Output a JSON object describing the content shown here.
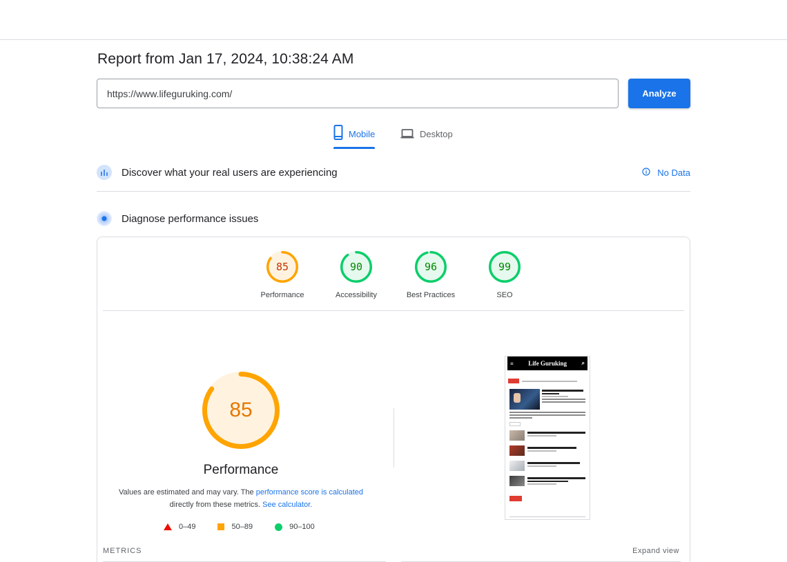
{
  "report": {
    "title": "Report from Jan 17, 2024, 10:38:24 AM"
  },
  "search": {
    "url": "https://www.lifeguruking.com/",
    "analyze_label": "Analyze"
  },
  "tabs": [
    {
      "label": "Mobile",
      "active": true,
      "icon": "smartphone-icon"
    },
    {
      "label": "Desktop",
      "active": false,
      "icon": "laptop-icon"
    }
  ],
  "field_data": {
    "title": "Discover what your real users are experiencing",
    "status": "No Data"
  },
  "diagnose": {
    "title": "Diagnose performance issues"
  },
  "scores": [
    {
      "label": "Performance",
      "value": 85,
      "color": "#ffa400",
      "text_color": "#c33300",
      "fill": "#fff3e0"
    },
    {
      "label": "Accessibility",
      "value": 90,
      "color": "#0cce6b",
      "text_color": "#008800",
      "fill": "#e6f9ee"
    },
    {
      "label": "Best Practices",
      "value": 96,
      "color": "#0cce6b",
      "text_color": "#008800",
      "fill": "#e6f9ee"
    },
    {
      "label": "SEO",
      "value": 99,
      "color": "#0cce6b",
      "text_color": "#008800",
      "fill": "#e6f9ee"
    }
  ],
  "performance": {
    "value": 85,
    "label": "Performance",
    "desc_prefix": "Values are estimated and may vary. The ",
    "desc_link1": "performance score is calculated",
    "desc_mid": " directly from these metrics. ",
    "desc_link2": "See calculator."
  },
  "legend": [
    {
      "range": "0–49",
      "shape": "triangle",
      "color": "#eb0f00"
    },
    {
      "range": "50–89",
      "shape": "square",
      "color": "#ffa400"
    },
    {
      "range": "90–100",
      "shape": "circle",
      "color": "#0cce6b"
    }
  ],
  "metrics": {
    "label": "METRICS",
    "expand_label": "Expand view"
  },
  "thumbnail": {
    "logo": "Life Guruking"
  }
}
